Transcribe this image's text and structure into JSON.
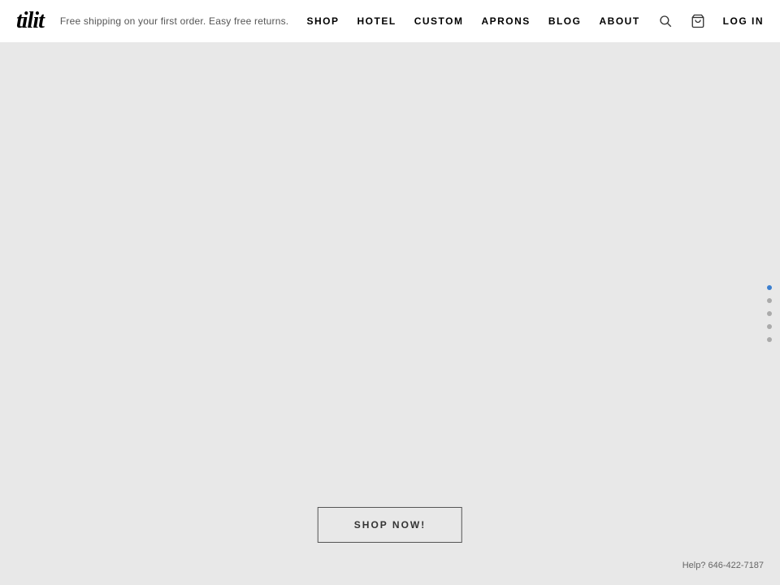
{
  "header": {
    "logo_text": "tilit",
    "tagline": "Free shipping on your first order. Easy free returns.",
    "nav_items": [
      {
        "label": "SHOP",
        "id": "shop"
      },
      {
        "label": "HOTEL",
        "id": "hotel"
      },
      {
        "label": "CUSTOM",
        "id": "custom"
      },
      {
        "label": "APRONS",
        "id": "aprons"
      },
      {
        "label": "BLOG",
        "id": "blog"
      },
      {
        "label": "ABOUT",
        "id": "about"
      },
      {
        "label": "LOG IN",
        "id": "login"
      }
    ]
  },
  "main": {
    "shop_now_label": "SHOP NOW!",
    "help_text": "Help? 646-422-7187"
  },
  "dot_nav": {
    "items": [
      {
        "active": true
      },
      {
        "active": false
      },
      {
        "active": false
      },
      {
        "active": false
      },
      {
        "active": false
      }
    ]
  }
}
